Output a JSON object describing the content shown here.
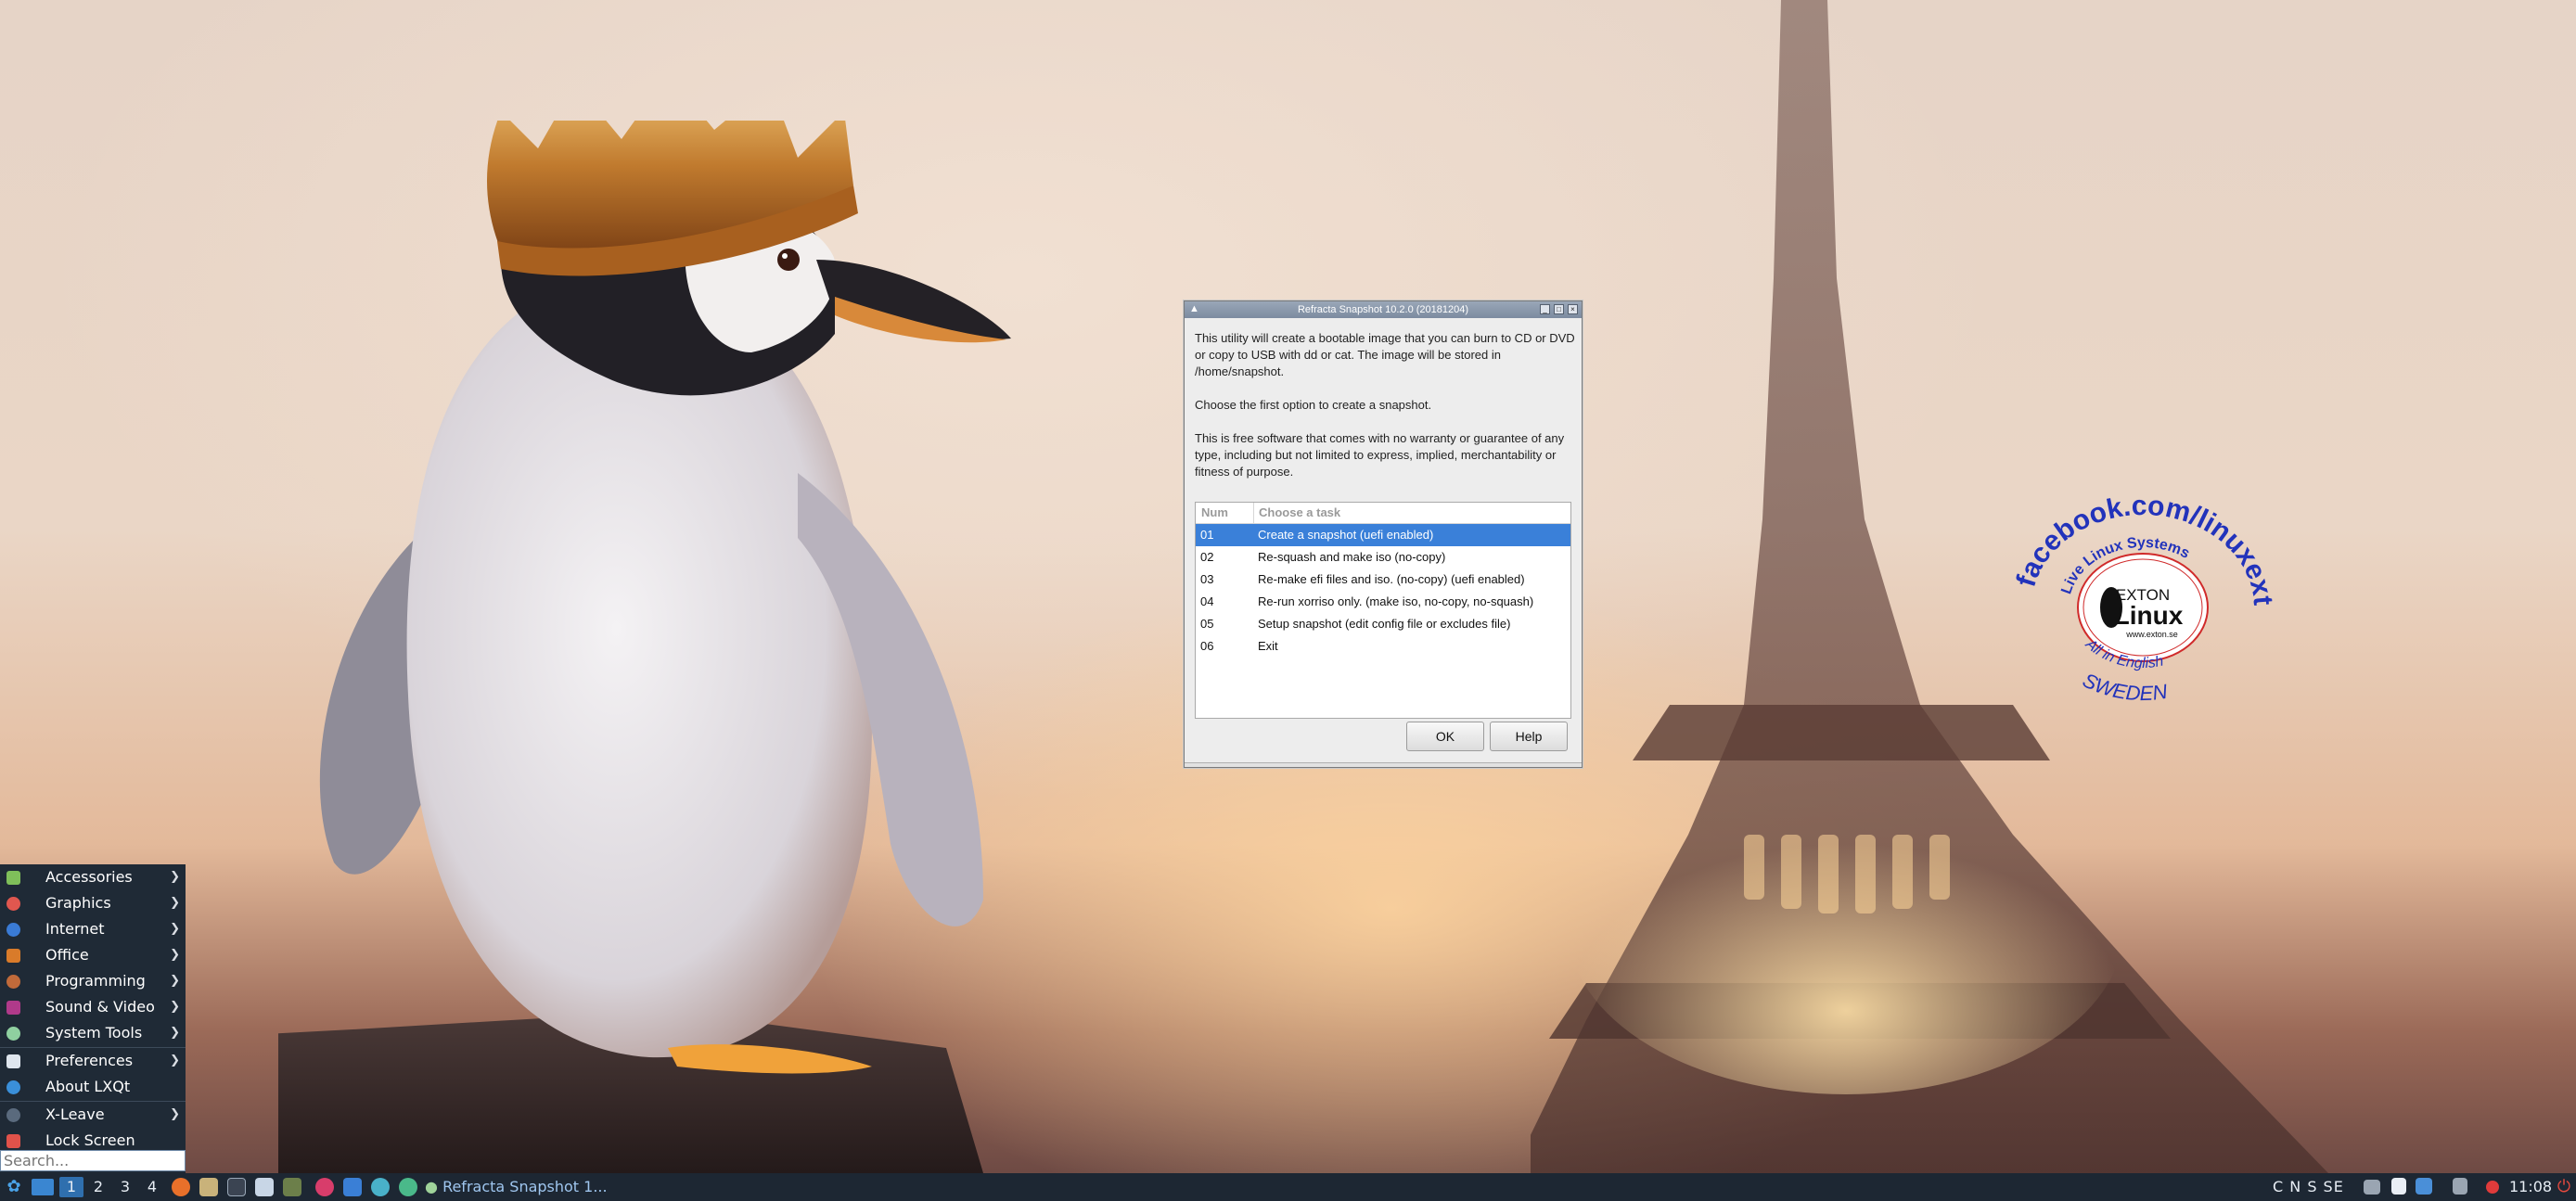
{
  "dialog": {
    "title": "Refracta Snapshot 10.2.0 (20181204)",
    "paragraph1": "This utility will create a bootable image that you can burn to CD or DVD or copy to USB with dd or cat. The image will be stored in /home/snapshot.",
    "paragraph2": "Choose the first option to create a snapshot.",
    "paragraph3": "This is free software that comes with no warranty or guarantee of any type, including but not limited to express, implied, merchantability or fitness of purpose.",
    "columns": {
      "num": "Num",
      "task": "Choose a task"
    },
    "rows": [
      {
        "num": "01",
        "task": "Create a snapshot (uefi enabled)"
      },
      {
        "num": "02",
        "task": "Re-squash and make iso (no-copy)"
      },
      {
        "num": "03",
        "task": "Re-make efi files and iso. (no-copy) (uefi enabled)"
      },
      {
        "num": "04",
        "task": "Re-run xorriso only. (make iso, no-copy, no-squash)"
      },
      {
        "num": "05",
        "task": "Setup snapshot (edit config file or excludes file)"
      },
      {
        "num": "06",
        "task": "Exit"
      }
    ],
    "selected_row": "01",
    "ok_label": "OK",
    "help_label": "Help"
  },
  "start_menu": {
    "items": [
      {
        "label": "Accessories",
        "icon": "accessories-icon",
        "color": "#7fbf5a",
        "submenu": true
      },
      {
        "label": "Graphics",
        "icon": "graphics-icon",
        "color": "#e0574f",
        "submenu": true
      },
      {
        "label": "Internet",
        "icon": "internet-icon",
        "color": "#3a7bd5",
        "submenu": true
      },
      {
        "label": "Office",
        "icon": "office-icon",
        "color": "#d97b2a",
        "submenu": true
      },
      {
        "label": "Programming",
        "icon": "programming-icon",
        "color": "#c06a3a",
        "submenu": true
      },
      {
        "label": "Sound & Video",
        "icon": "sound-video-icon",
        "color": "#b03a8a",
        "submenu": true
      },
      {
        "label": "System Tools",
        "icon": "system-tools-icon",
        "color": "#8fd0a0",
        "submenu": true
      },
      {
        "label": "Preferences",
        "icon": "preferences-icon",
        "color": "#dfe6ee",
        "submenu": true
      },
      {
        "label": "About LXQt",
        "icon": "about-lxqt-icon",
        "color": "#3a8fd9",
        "submenu": false
      },
      {
        "label": "X-Leave",
        "icon": "x-leave-icon",
        "color": "#5a6a7d",
        "submenu": true
      },
      {
        "label": "Lock Screen",
        "icon": "lock-screen-icon",
        "color": "#e0524a",
        "submenu": false
      }
    ],
    "search_placeholder": "Search..."
  },
  "taskbar": {
    "workspaces": [
      "1",
      "2",
      "3",
      "4"
    ],
    "active_workspace": "1",
    "task_button_label": "Refracta Snapshot 1...",
    "tray_text": "C N S SE",
    "clock": "11:08"
  },
  "wallpaper": {
    "badge_arc_top": "facebook.com/linuxexton",
    "badge_arc_inner": "Live Linux Systems",
    "badge_arc_bottom": "SWEDEN",
    "badge_inner_bottom": "All in English",
    "badge_brand_small": "EXTON",
    "badge_brand_big": "Linux",
    "badge_url": "www.exton.se",
    "colors": {
      "badge_text": "#2233bb",
      "badge_ring": "#d02a2a"
    }
  }
}
